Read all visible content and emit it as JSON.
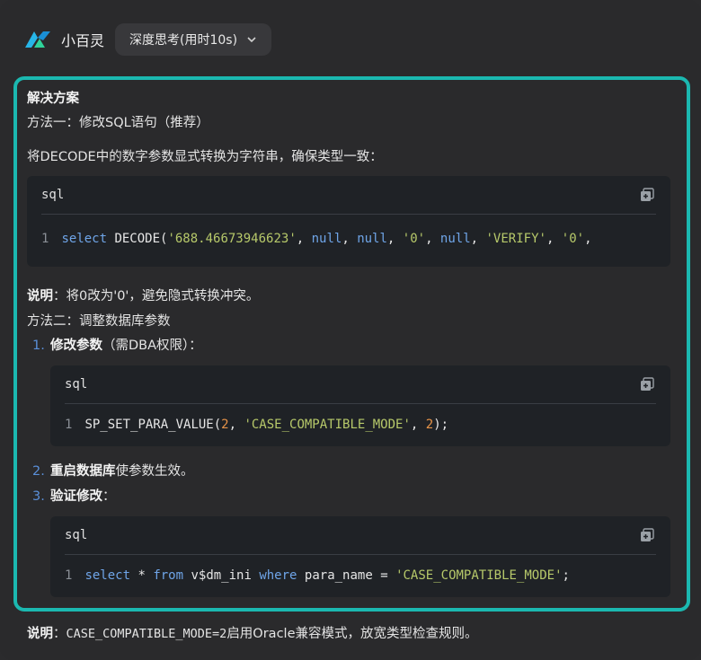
{
  "app": {
    "name": "小百灵",
    "mode_label": "深度思考(用时10s)"
  },
  "section": {
    "title": "解决方案",
    "method1_heading": "方法一：修改SQL语句（推荐）",
    "method1_desc": "将DECODE中的数字参数显式转换为字符串，确保类型一致：",
    "note1_label": "说明",
    "note1_text": "：将0改为'0'，避免隐式转换冲突。",
    "method2_heading": "方法二：调整数据库参数",
    "steps": [
      {
        "num": "1.",
        "bold": "修改参数",
        "rest": "（需DBA权限）："
      },
      {
        "num": "2.",
        "bold": "重启数据库",
        "rest": "使参数生效。"
      },
      {
        "num": "3.",
        "bold": "验证修改",
        "rest": "："
      }
    ]
  },
  "code_blocks": [
    {
      "lang": "sql",
      "line_no": "1",
      "tokens": [
        {
          "t": "select",
          "c": "kw"
        },
        {
          "t": " DECODE(",
          "c": ""
        },
        {
          "t": "'688.46673946623'",
          "c": "str"
        },
        {
          "t": ", ",
          "c": ""
        },
        {
          "t": "null",
          "c": "kw"
        },
        {
          "t": ", ",
          "c": ""
        },
        {
          "t": "null",
          "c": "kw"
        },
        {
          "t": ", ",
          "c": ""
        },
        {
          "t": "'0'",
          "c": "str"
        },
        {
          "t": ", ",
          "c": ""
        },
        {
          "t": "null",
          "c": "kw"
        },
        {
          "t": ", ",
          "c": ""
        },
        {
          "t": "'VERIFY'",
          "c": "str"
        },
        {
          "t": ", ",
          "c": ""
        },
        {
          "t": "'0'",
          "c": "str"
        },
        {
          "t": ",",
          "c": ""
        }
      ]
    },
    {
      "lang": "sql",
      "line_no": "1",
      "tokens": [
        {
          "t": "SP_SET_PARA_VALUE(",
          "c": ""
        },
        {
          "t": "2",
          "c": "num"
        },
        {
          "t": ", ",
          "c": ""
        },
        {
          "t": "'CASE_COMPATIBLE_MODE'",
          "c": "str"
        },
        {
          "t": ", ",
          "c": ""
        },
        {
          "t": "2",
          "c": "num"
        },
        {
          "t": ");",
          "c": ""
        }
      ]
    },
    {
      "lang": "sql",
      "line_no": "1",
      "tokens": [
        {
          "t": "select",
          "c": "kw"
        },
        {
          "t": " * ",
          "c": ""
        },
        {
          "t": "from",
          "c": "kw"
        },
        {
          "t": " v$dm_ini ",
          "c": ""
        },
        {
          "t": "where",
          "c": "kw"
        },
        {
          "t": " para_name = ",
          "c": ""
        },
        {
          "t": "'CASE_COMPATIBLE_MODE'",
          "c": "str"
        },
        {
          "t": ";",
          "c": ""
        }
      ]
    }
  ],
  "footer": {
    "label": "说明",
    "sep": "：",
    "code": "CASE_COMPATIBLE_MODE=2",
    "text": "启用Oracle兼容模式，放宽类型检查规则。"
  },
  "colors": {
    "accent": "#1bb8b0",
    "keyword": "#6fa5e8",
    "string": "#b7c96a",
    "number": "#e69348"
  },
  "icons": {
    "copy": "copy-icon",
    "chevron": "chevron-down-icon",
    "logo": "app-logo-icon"
  }
}
